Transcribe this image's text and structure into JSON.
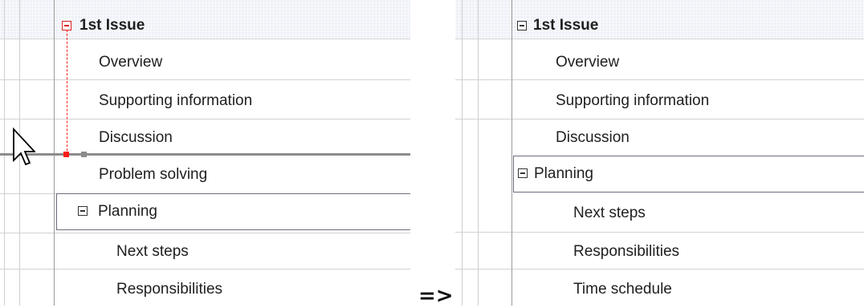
{
  "before": {
    "header": "1st Issue",
    "rows": [
      "Overview",
      "Supporting information",
      "Discussion",
      "Problem solving"
    ],
    "selected": "Planning",
    "children": [
      "Next steps",
      "Responsibilities"
    ]
  },
  "after": {
    "header": "1st Issue",
    "rows": [
      "Overview",
      "Supporting information",
      "Discussion"
    ],
    "selected": "Planning",
    "children": [
      "Next steps",
      "Responsibilities",
      "Time schedule"
    ]
  },
  "separator": "=>",
  "icons": {
    "collapse": "minus-box-icon",
    "cursor": "mouse-pointer-icon"
  },
  "colors": {
    "drop_indicator": "#ff1a1a",
    "header_band": "#eef1f7",
    "selection_border": "#6e6e7e"
  }
}
